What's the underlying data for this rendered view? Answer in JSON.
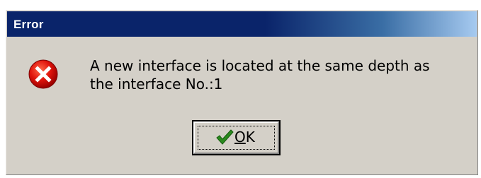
{
  "dialog": {
    "title": "Error",
    "icon": "error-icon",
    "message_lines": [
      "A new interface is located at the same depth as",
      "the interface No.:1"
    ],
    "ok_button": {
      "mnemonic": "O",
      "rest": "K",
      "icon": "checkmark-icon"
    }
  },
  "colors": {
    "title_bar": "#0a246a",
    "dialog_face": "#d4d0c8",
    "error_red": "#e0140c",
    "check_green": "#2a8a1e"
  }
}
